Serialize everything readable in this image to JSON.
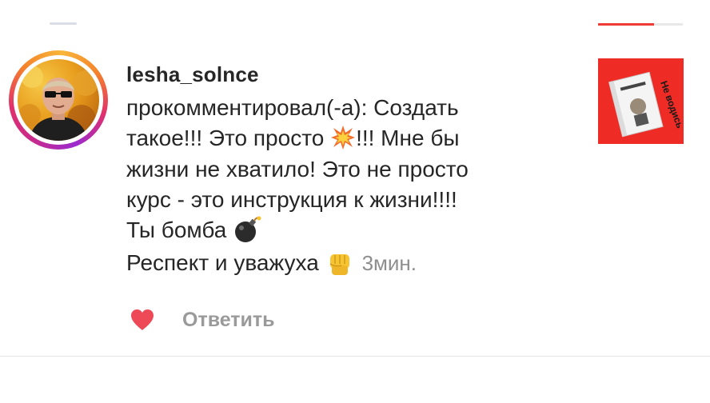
{
  "comment": {
    "username": "lesha_solnce",
    "lines": {
      "l1": "прокомментировал(-а): Создать",
      "l2a": "такое!!! Это просто ",
      "l2b": "!!! Мне бы",
      "l3": "жизни не хватило! Это не просто",
      "l4": "курс - это инструкция к жизни!!!!",
      "l5": "Ты бомба ",
      "l6": "Респект и уважуха "
    },
    "time": "3мин.",
    "reply_label": "Ответить"
  },
  "post_thumbnail": {
    "text": "Не водись"
  },
  "colors": {
    "text": "#262626",
    "muted": "#8e8e8e",
    "like": "#ed4956",
    "thumb_bg": "#ee2b24"
  },
  "icons": {
    "avatar": "user-photo",
    "heart": "heart-icon",
    "emoji_boom": "collision-emoji",
    "emoji_bomb": "bomb-emoji",
    "emoji_fist": "raised-fist-emoji"
  }
}
